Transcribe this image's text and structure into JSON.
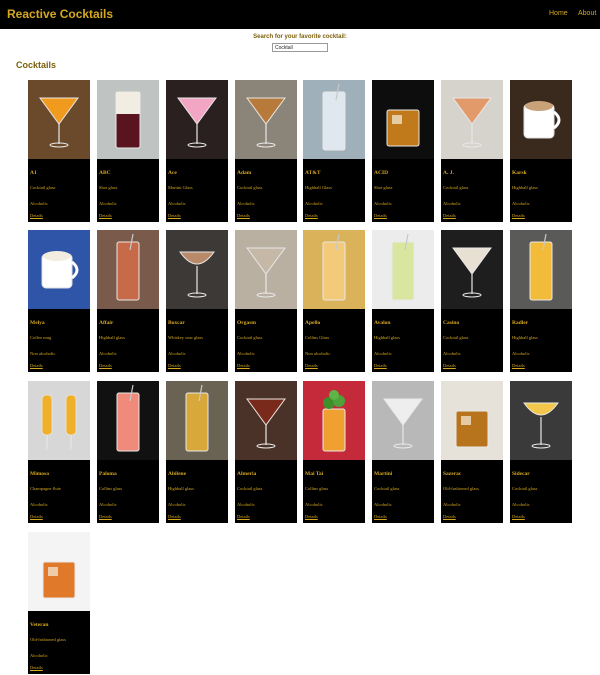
{
  "navbar": {
    "brand": "Reactive Cocktails",
    "links": [
      "Home",
      "About"
    ]
  },
  "search": {
    "label": "Search for your favorite cocktail:",
    "value": "Cocktail"
  },
  "section_title": "Cocktails",
  "colors": {
    "background": "#ffffff",
    "navbar": "#000000",
    "accent_gold": "#d6a820",
    "heading_olive": "#7a5f0a",
    "card": "#000000"
  },
  "cocktails": [
    {
      "name": "A1",
      "glass": "Cocktail glass",
      "alcoholic": "Alcoholic",
      "details": "Details",
      "image": {
        "icon": "martini-glass-icon",
        "bg": "#6b4a2b",
        "liquid": "#f09a1e"
      }
    },
    {
      "name": "ABC",
      "glass": "Shot glass",
      "alcoholic": "Alcoholic",
      "details": "Details",
      "image": {
        "icon": "shot-glass-icon",
        "bg": "#bfc4c2",
        "liquid": "#5a1420"
      }
    },
    {
      "name": "Ace",
      "glass": "Martini Glass",
      "alcoholic": "Alcoholic",
      "details": "Details",
      "image": {
        "icon": "martini-glass-icon",
        "bg": "#2a2020",
        "liquid": "#f2a6c4"
      }
    },
    {
      "name": "Adam",
      "glass": "Cocktail glass",
      "alcoholic": "Alcoholic",
      "details": "Details",
      "image": {
        "icon": "martini-glass-icon",
        "bg": "#8a8578",
        "liquid": "#b87a3a"
      }
    },
    {
      "name": "AT&T",
      "glass": "Highball Glass",
      "alcoholic": "Alcoholic",
      "details": "Details",
      "image": {
        "icon": "highball-glass-icon",
        "bg": "#9fb0bb",
        "liquid": "#dfe8ee"
      }
    },
    {
      "name": "ACID",
      "glass": "Shot glass",
      "alcoholic": "Alcoholic",
      "details": "Details",
      "image": {
        "icon": "old-fashioned-glass-icon",
        "bg": "#0d0d0d",
        "liquid": "#c07a1c"
      }
    },
    {
      "name": "A. J.",
      "glass": "Cocktail glass",
      "alcoholic": "Alcoholic",
      "details": "Details",
      "image": {
        "icon": "martini-glass-icon",
        "bg": "#d6d2cc",
        "liquid": "#e39a6a"
      }
    },
    {
      "name": "Karsk",
      "glass": "Highball glass",
      "alcoholic": "Alcoholic",
      "details": "Details",
      "image": {
        "icon": "coffee-cup-icon",
        "bg": "#3a2a1e",
        "liquid": "#c9a27a"
      }
    },
    {
      "name": "Melya",
      "glass": "Coffee mug",
      "alcoholic": "Non alcoholic",
      "details": "Details",
      "image": {
        "icon": "coffee-mug-icon",
        "bg": "#2f55a8",
        "liquid": "#f3ede0"
      }
    },
    {
      "name": "Affair",
      "glass": "Highball glass",
      "alcoholic": "Alcoholic",
      "details": "Details",
      "image": {
        "icon": "highball-glass-icon",
        "bg": "#7a5a4a",
        "liquid": "#c66a4a"
      }
    },
    {
      "name": "Boxcar",
      "glass": "Whiskey sour glass",
      "alcoholic": "Alcoholic",
      "details": "Details",
      "image": {
        "icon": "coupe-glass-icon",
        "bg": "#3d3936",
        "liquid": "#b98a6a"
      }
    },
    {
      "name": "Orgasm",
      "glass": "Cocktail glass",
      "alcoholic": "Alcoholic",
      "details": "Details",
      "image": {
        "icon": "martini-glass-icon",
        "bg": "#b9b0a2",
        "liquid": "#c6b8a6"
      }
    },
    {
      "name": "Apello",
      "glass": "Collins Glass",
      "alcoholic": "Non alcoholic",
      "details": "Details",
      "image": {
        "icon": "collins-glass-icon",
        "bg": "#d9b25a",
        "liquid": "#f3c97a"
      }
    },
    {
      "name": "Avalon",
      "glass": "Highball glass",
      "alcoholic": "Alcoholic",
      "details": "Details",
      "image": {
        "icon": "highball-glass-icon",
        "bg": "#ececec",
        "liquid": "#d9e6a0"
      }
    },
    {
      "name": "Casino",
      "glass": "Cocktail glass",
      "alcoholic": "Alcoholic",
      "details": "Details",
      "image": {
        "icon": "martini-glass-icon",
        "bg": "#1e1e1e",
        "liquid": "#e8e0d2"
      }
    },
    {
      "name": "Radler",
      "glass": "Highball glass",
      "alcoholic": "Alcoholic",
      "details": "Details",
      "image": {
        "icon": "highball-glass-icon",
        "bg": "#5a5a58",
        "liquid": "#f2bb3a"
      }
    },
    {
      "name": "Mimosa",
      "glass": "Champagne flute",
      "alcoholic": "Alcoholic",
      "details": "Details",
      "image": {
        "icon": "champagne-flute-icon",
        "bg": "#d7d7d7",
        "liquid": "#f0b02a"
      }
    },
    {
      "name": "Paloma",
      "glass": "Collins glass",
      "alcoholic": "Alcoholic",
      "details": "Details",
      "image": {
        "icon": "collins-glass-icon",
        "bg": "#111111",
        "liquid": "#f08a7a"
      }
    },
    {
      "name": "Abilene",
      "glass": "Highball glass",
      "alcoholic": "Alcoholic",
      "details": "Details",
      "image": {
        "icon": "highball-glass-icon",
        "bg": "#6a6252",
        "liquid": "#d9a83a"
      }
    },
    {
      "name": "Almeria",
      "glass": "Cocktail glass",
      "alcoholic": "Alcoholic",
      "details": "Details",
      "image": {
        "icon": "martini-glass-icon",
        "bg": "#4a3228",
        "liquid": "#7a2a1a"
      }
    },
    {
      "name": "Mai Tai",
      "glass": "Collins glass",
      "alcoholic": "Alcoholic",
      "details": "Details",
      "image": {
        "icon": "mint-garnish-icon",
        "bg": "#c42a3a",
        "liquid": "#f0a030"
      }
    },
    {
      "name": "Martini",
      "glass": "Cocktail glass",
      "alcoholic": "Alcoholic",
      "details": "Details",
      "image": {
        "icon": "martini-glass-icon",
        "bg": "#b8b8b8",
        "liquid": "#eeeeee"
      }
    },
    {
      "name": "Sazerac",
      "glass": "Old-fashioned glass",
      "alcoholic": "Alcoholic",
      "details": "Details",
      "image": {
        "icon": "old-fashioned-glass-icon",
        "bg": "#e6e2da",
        "liquid": "#b8741c"
      }
    },
    {
      "name": "Sidecar",
      "glass": "Cocktail glass",
      "alcoholic": "Alcoholic",
      "details": "Details",
      "image": {
        "icon": "coupe-glass-icon",
        "bg": "#3a3a3a",
        "liquid": "#f2c74a"
      }
    },
    {
      "name": "Veteran",
      "glass": "Old-fashioned glass",
      "alcoholic": "Alcoholic",
      "details": "Details",
      "image": {
        "icon": "old-fashioned-glass-icon",
        "bg": "#f4f4f4",
        "liquid": "#e07a2a"
      }
    }
  ]
}
